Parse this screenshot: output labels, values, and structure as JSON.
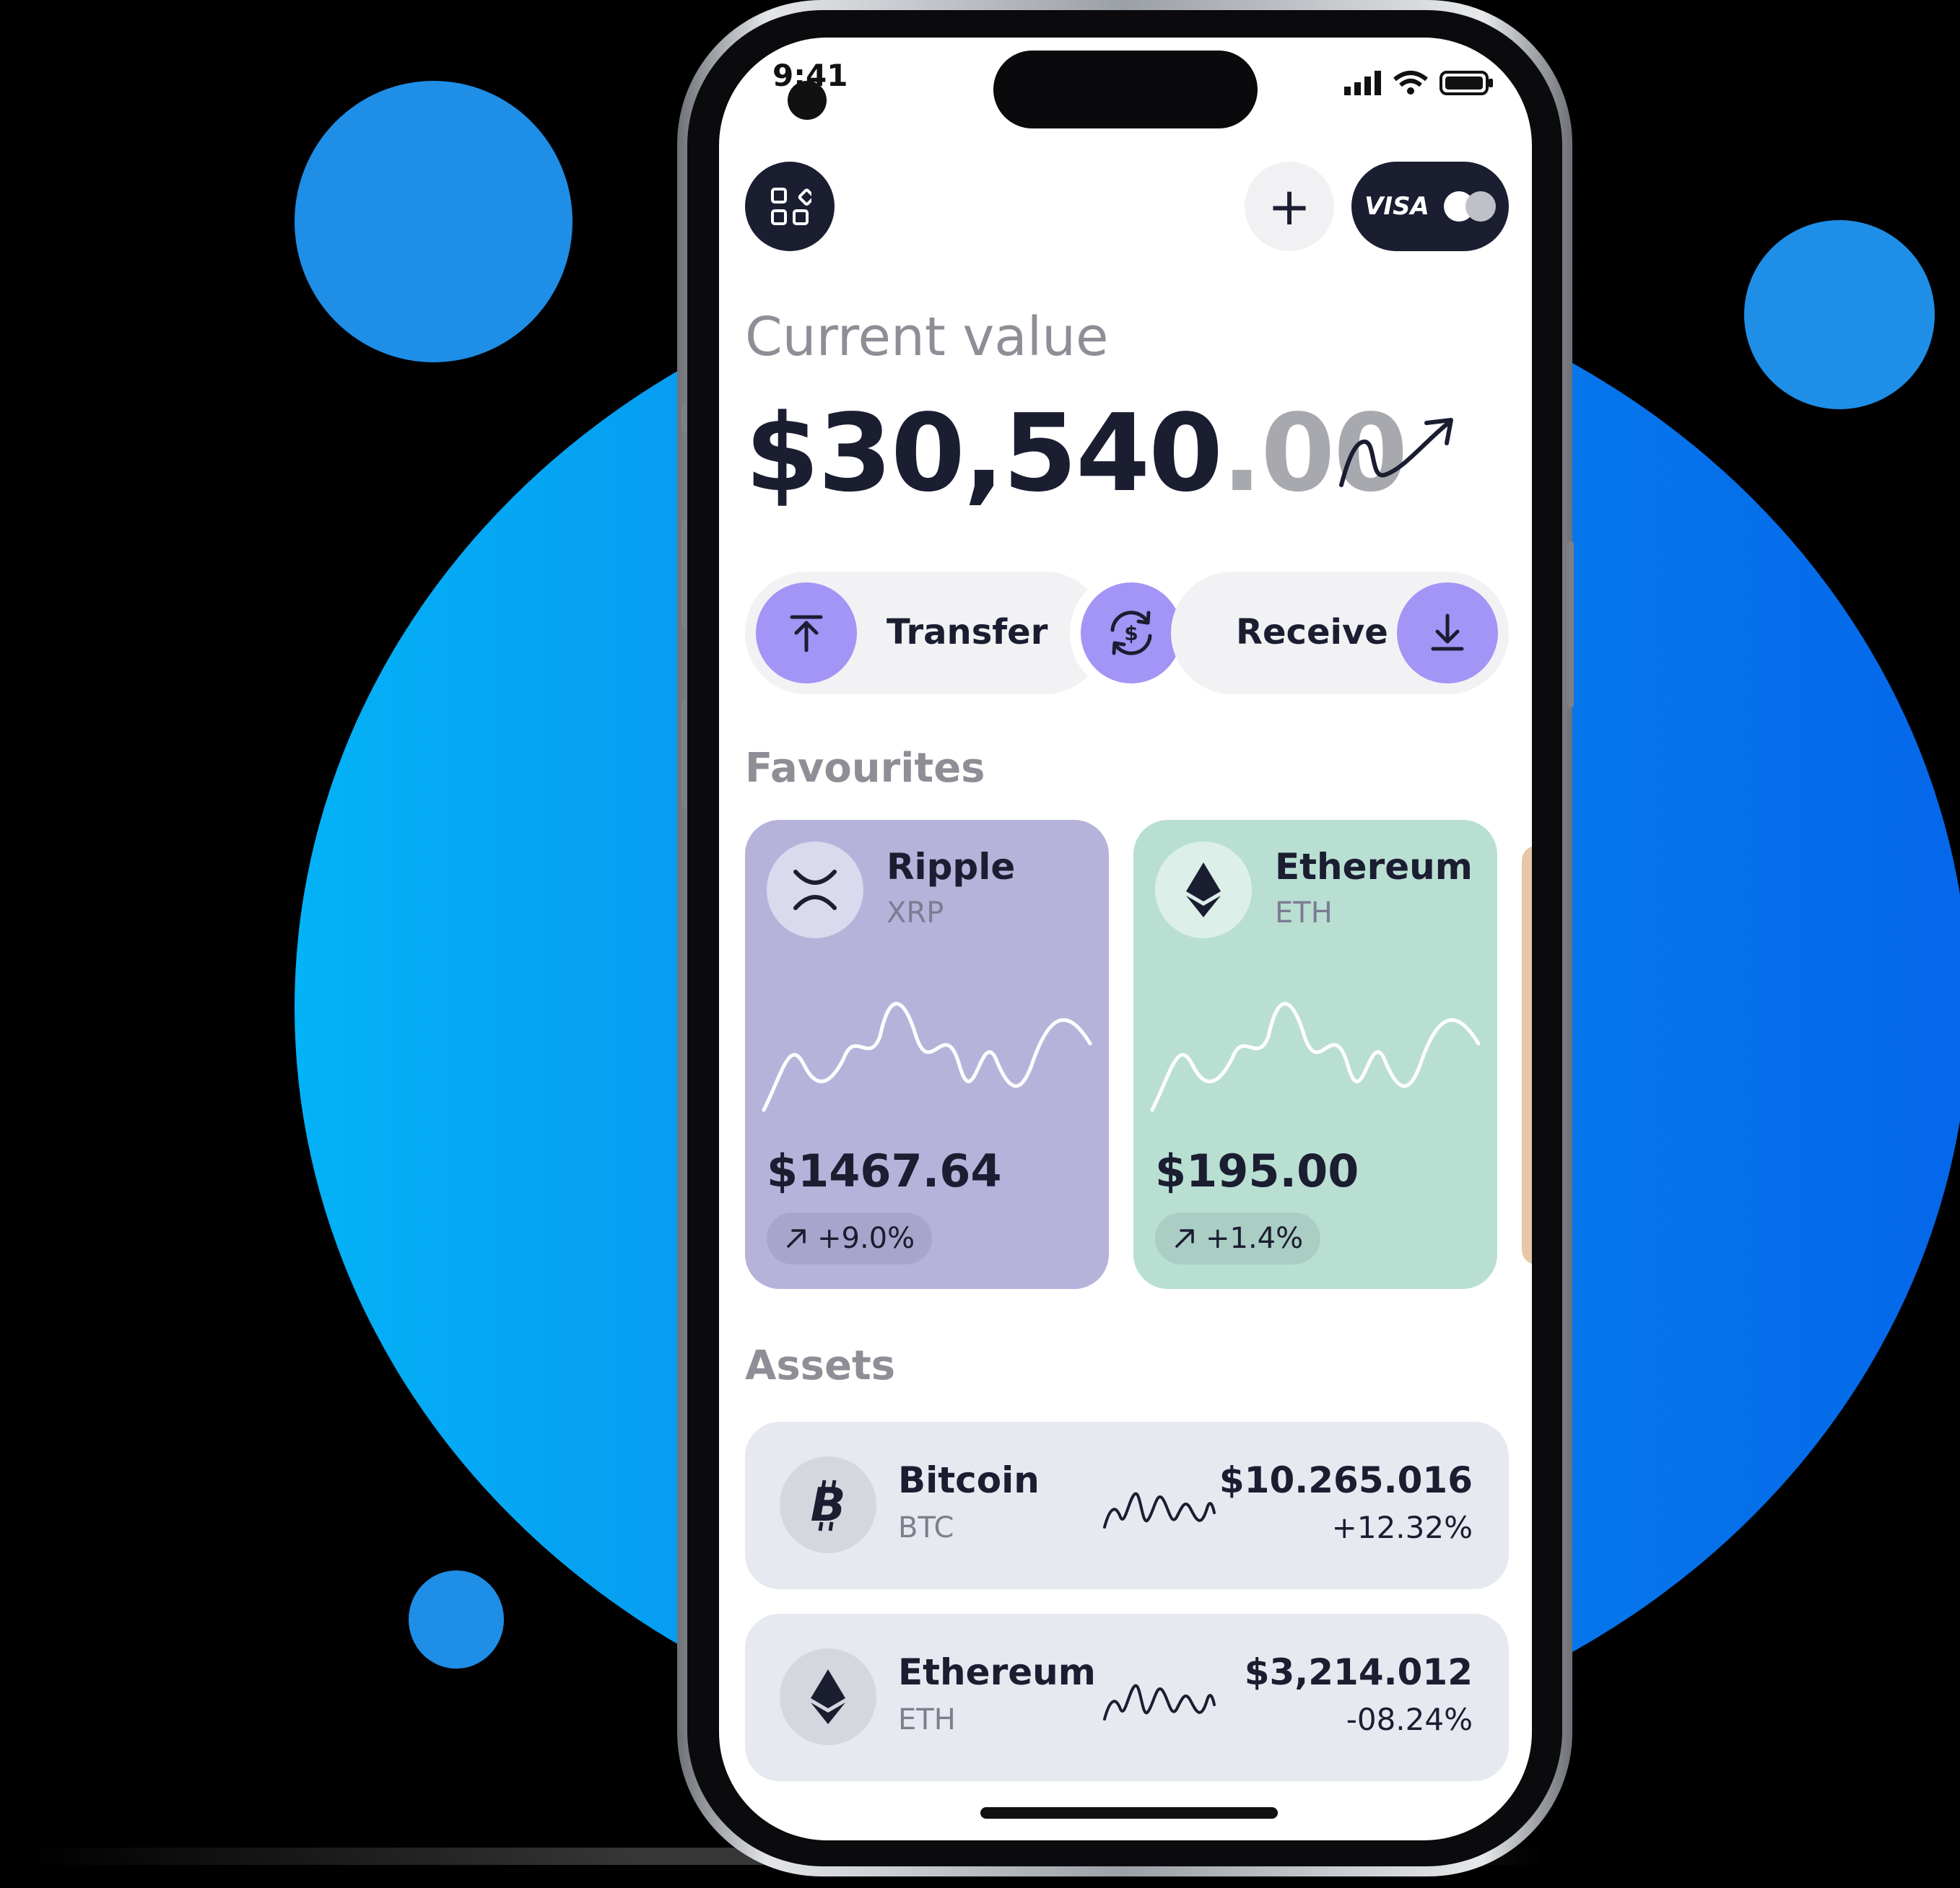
{
  "status_bar": {
    "time": "9:41",
    "icons": "▂▄▆ ⌔ ▭"
  },
  "header": {
    "plus_icon": "+",
    "visa_label": "VISA"
  },
  "current": {
    "label": "Current value",
    "value_main": "$30,540",
    "value_cents": ".00"
  },
  "actions": {
    "transfer_label": "Transfer",
    "receive_label": "Receive"
  },
  "favourites": {
    "title": "Favourites",
    "items": [
      {
        "name": "Ripple",
        "symbol": "XRP",
        "price": "$1467.64",
        "change": "+9.0%",
        "color": "#b6b3db"
      },
      {
        "name": "Ethereum",
        "symbol": "ETH",
        "price": "$195.00",
        "change": "+1.4%",
        "color": "#b9dfd3"
      }
    ]
  },
  "assets": {
    "title": "Assets",
    "items": [
      {
        "name": "Bitcoin",
        "symbol": "BTC",
        "price": "$10.265.016",
        "change": "+12.32%"
      },
      {
        "name": "Ethereum",
        "symbol": "ETH",
        "price": "$3,214.012",
        "change": "-08.24%"
      }
    ]
  },
  "colors": {
    "accent_purple": "#a395f6",
    "dark_navy": "#1b1d31",
    "background_blue": "#0789ec"
  }
}
